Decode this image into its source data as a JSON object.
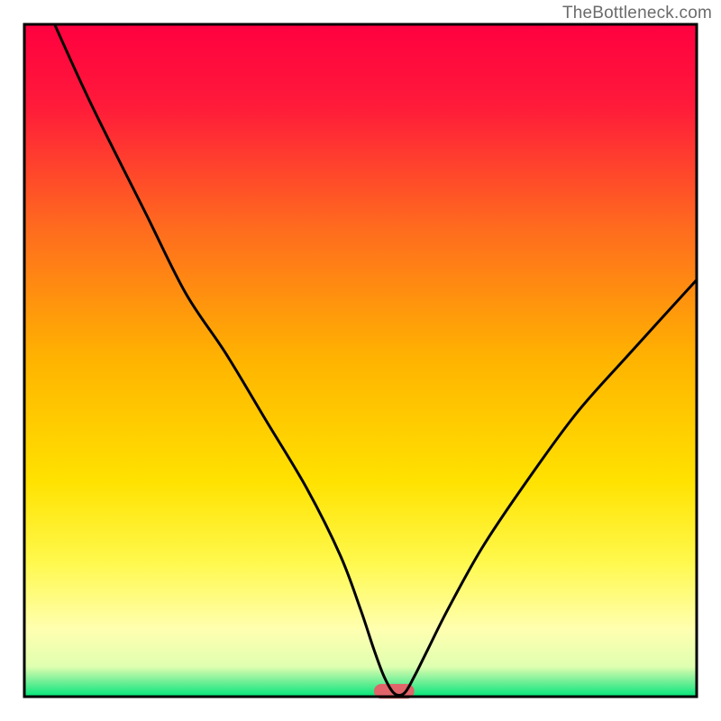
{
  "watermark": "TheBottleneck.com",
  "chart_data": {
    "type": "line",
    "title": "",
    "xlabel": "",
    "ylabel": "",
    "xlim": [
      0,
      100
    ],
    "ylim": [
      0,
      100
    ],
    "border": {
      "left": true,
      "right": true,
      "top": true,
      "bottom": true,
      "color": "#000000",
      "width": 3
    },
    "background_gradient": {
      "type": "vertical",
      "stops": [
        {
          "offset": 0.0,
          "color": "#ff0040"
        },
        {
          "offset": 0.12,
          "color": "#ff1a3a"
        },
        {
          "offset": 0.3,
          "color": "#ff6a1f"
        },
        {
          "offset": 0.5,
          "color": "#ffb400"
        },
        {
          "offset": 0.68,
          "color": "#ffe200"
        },
        {
          "offset": 0.8,
          "color": "#fff94d"
        },
        {
          "offset": 0.9,
          "color": "#ffffb0"
        },
        {
          "offset": 0.955,
          "color": "#e0ffb0"
        },
        {
          "offset": 0.975,
          "color": "#7ff09a"
        },
        {
          "offset": 1.0,
          "color": "#00e67a"
        }
      ]
    },
    "series": [
      {
        "name": "bottleneck-curve",
        "stroke": "#000000",
        "stroke_width": 3,
        "x": [
          4.5,
          10,
          18,
          24,
          30,
          36,
          42,
          47,
          50,
          52,
          53.5,
          55,
          56.5,
          58,
          60,
          63,
          68,
          74,
          82,
          90,
          100
        ],
        "y": [
          100,
          88,
          72,
          60,
          51,
          41,
          31,
          21,
          13,
          7,
          3,
          0.5,
          0.5,
          3,
          7,
          13,
          22,
          31,
          42,
          51,
          62
        ]
      }
    ],
    "markers": [
      {
        "name": "valley-floor-marker",
        "shape": "rounded-rect",
        "x": 55,
        "y": 0.8,
        "width_x": 6.0,
        "height_y": 2.2,
        "fill": "#e0646a"
      }
    ]
  }
}
